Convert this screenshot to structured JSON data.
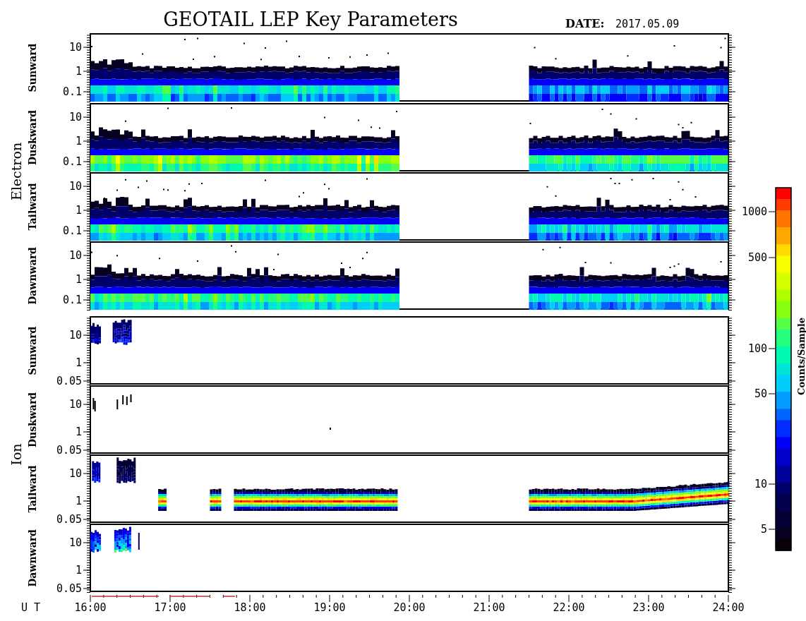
{
  "title": "GEOTAIL LEP Key Parameters",
  "date": {
    "label": "DATE:",
    "value": "2017.05.09"
  },
  "groups": [
    {
      "label": "Electron",
      "kind": "electron",
      "panels": [
        {
          "label": "Sunward",
          "yticks": [
            "10",
            "1",
            "0.1"
          ]
        },
        {
          "label": "Duskward",
          "yticks": [
            "10",
            "1",
            "0.1"
          ]
        },
        {
          "label": "Tailward",
          "yticks": [
            "10",
            "1",
            "0.1"
          ]
        },
        {
          "label": "Dawnward",
          "yticks": [
            "10",
            "1",
            "0.1"
          ]
        }
      ]
    },
    {
      "label": "Ion",
      "kind": "ion",
      "panels": [
        {
          "label": "Sunward",
          "yticks": [
            "10",
            "1",
            "0.05"
          ]
        },
        {
          "label": "Duskward",
          "yticks": [
            "10",
            "1",
            "0.05"
          ]
        },
        {
          "label": "Tailward",
          "yticks": [
            "10",
            "1",
            "0.05"
          ]
        },
        {
          "label": "Dawnward",
          "yticks": [
            "10",
            "1",
            "0.05"
          ]
        }
      ]
    }
  ],
  "x_axis": {
    "label": "U T",
    "ticks": [
      "16:00",
      "17:00",
      "18:00",
      "19:00",
      "20:00",
      "21:00",
      "22:00",
      "23:00",
      "24:00"
    ]
  },
  "colorbar": {
    "label": "Counts/Sample",
    "ticks": [
      "1000",
      "500",
      "100",
      "50",
      "10",
      "5"
    ]
  }
}
